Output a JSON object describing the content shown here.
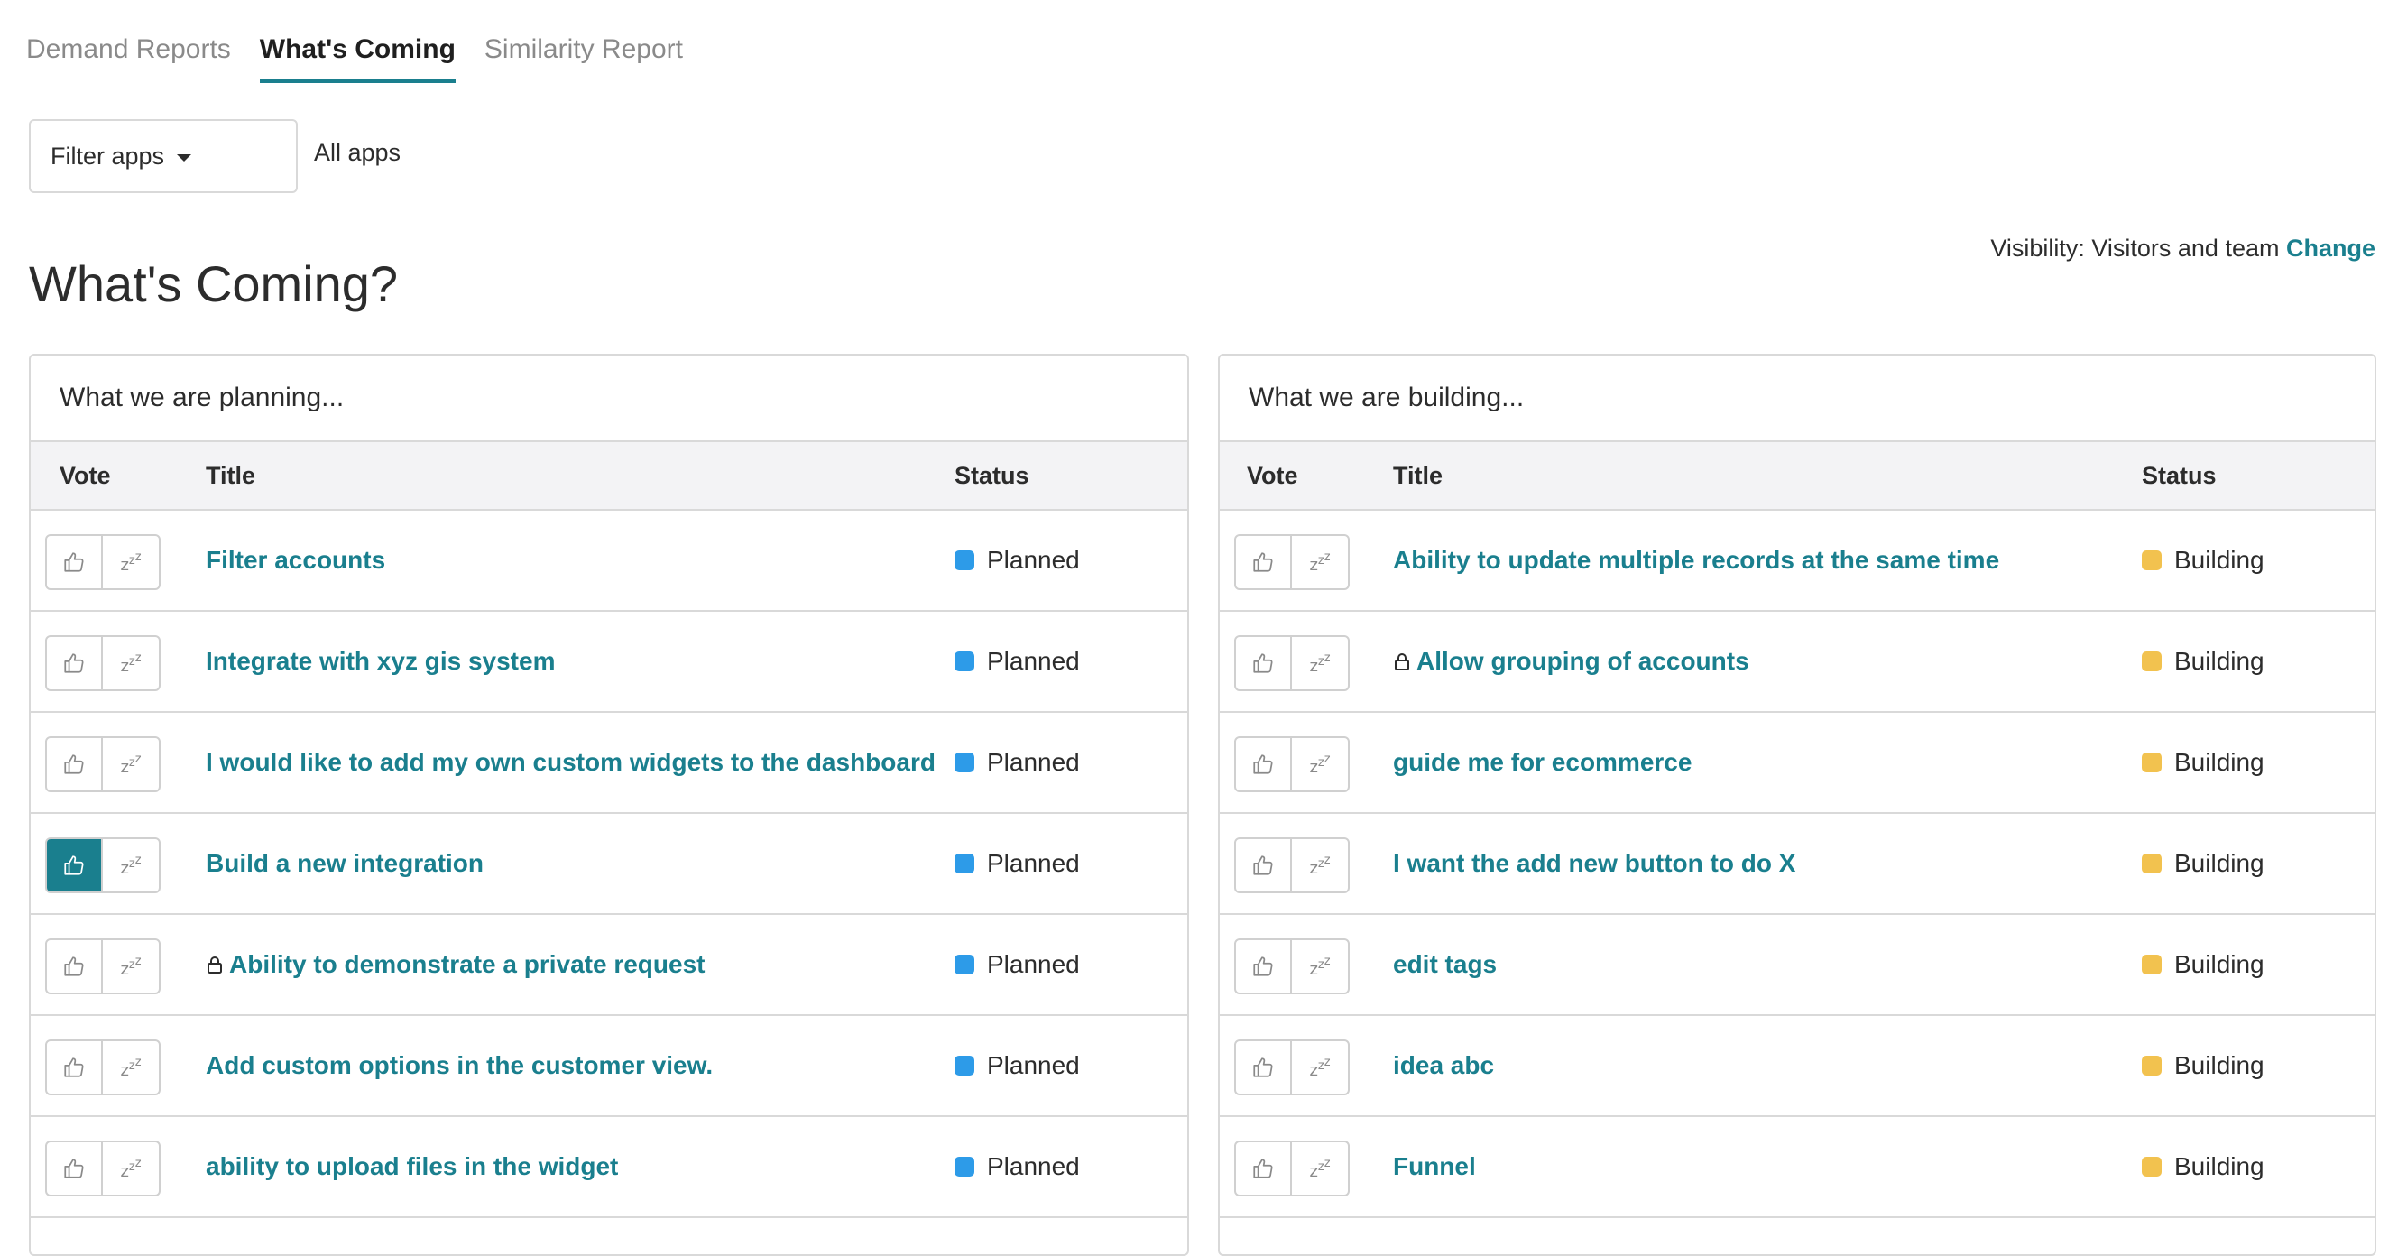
{
  "tabs": [
    {
      "label": "Demand Reports",
      "active": false
    },
    {
      "label": "What's Coming",
      "active": true
    },
    {
      "label": "Similarity Report",
      "active": false
    }
  ],
  "filter": {
    "button_label": "Filter apps",
    "selected": "All apps"
  },
  "visibility": {
    "label": "Visibility: Visitors and team",
    "link": "Change"
  },
  "page_title": "What's Coming?",
  "colors": {
    "accent": "#1a7f8e",
    "planned": "#2d9be8",
    "building": "#f2c24f"
  },
  "panels": {
    "planning": {
      "header": "What we are planning...",
      "columns": {
        "vote": "Vote",
        "title": "Title",
        "status": "Status"
      },
      "rows": [
        {
          "title": "Filter accounts",
          "status": "Planned",
          "locked": false,
          "voted": false
        },
        {
          "title": "Integrate with xyz gis system",
          "status": "Planned",
          "locked": false,
          "voted": false
        },
        {
          "title": "I would like to add my own custom widgets to the dashboard",
          "status": "Planned",
          "locked": false,
          "voted": false
        },
        {
          "title": "Build a new integration",
          "status": "Planned",
          "locked": false,
          "voted": true
        },
        {
          "title": "Ability to demonstrate a private request",
          "status": "Planned",
          "locked": true,
          "voted": false
        },
        {
          "title": "Add custom options in the customer view.",
          "status": "Planned",
          "locked": false,
          "voted": false
        },
        {
          "title": "ability to upload files in the widget",
          "status": "Planned",
          "locked": false,
          "voted": false
        }
      ]
    },
    "building": {
      "header": "What we are building...",
      "columns": {
        "vote": "Vote",
        "title": "Title",
        "status": "Status"
      },
      "rows": [
        {
          "title": "Ability to update multiple records at the same time",
          "status": "Building",
          "locked": false,
          "voted": false
        },
        {
          "title": "Allow grouping of accounts",
          "status": "Building",
          "locked": true,
          "voted": false
        },
        {
          "title": "guide me for ecommerce",
          "status": "Building",
          "locked": false,
          "voted": false
        },
        {
          "title": "I want the add new button to do X",
          "status": "Building",
          "locked": false,
          "voted": false
        },
        {
          "title": "edit tags",
          "status": "Building",
          "locked": false,
          "voted": false
        },
        {
          "title": "idea abc",
          "status": "Building",
          "locked": false,
          "voted": false
        },
        {
          "title": "Funnel",
          "status": "Building",
          "locked": false,
          "voted": false
        }
      ]
    }
  }
}
